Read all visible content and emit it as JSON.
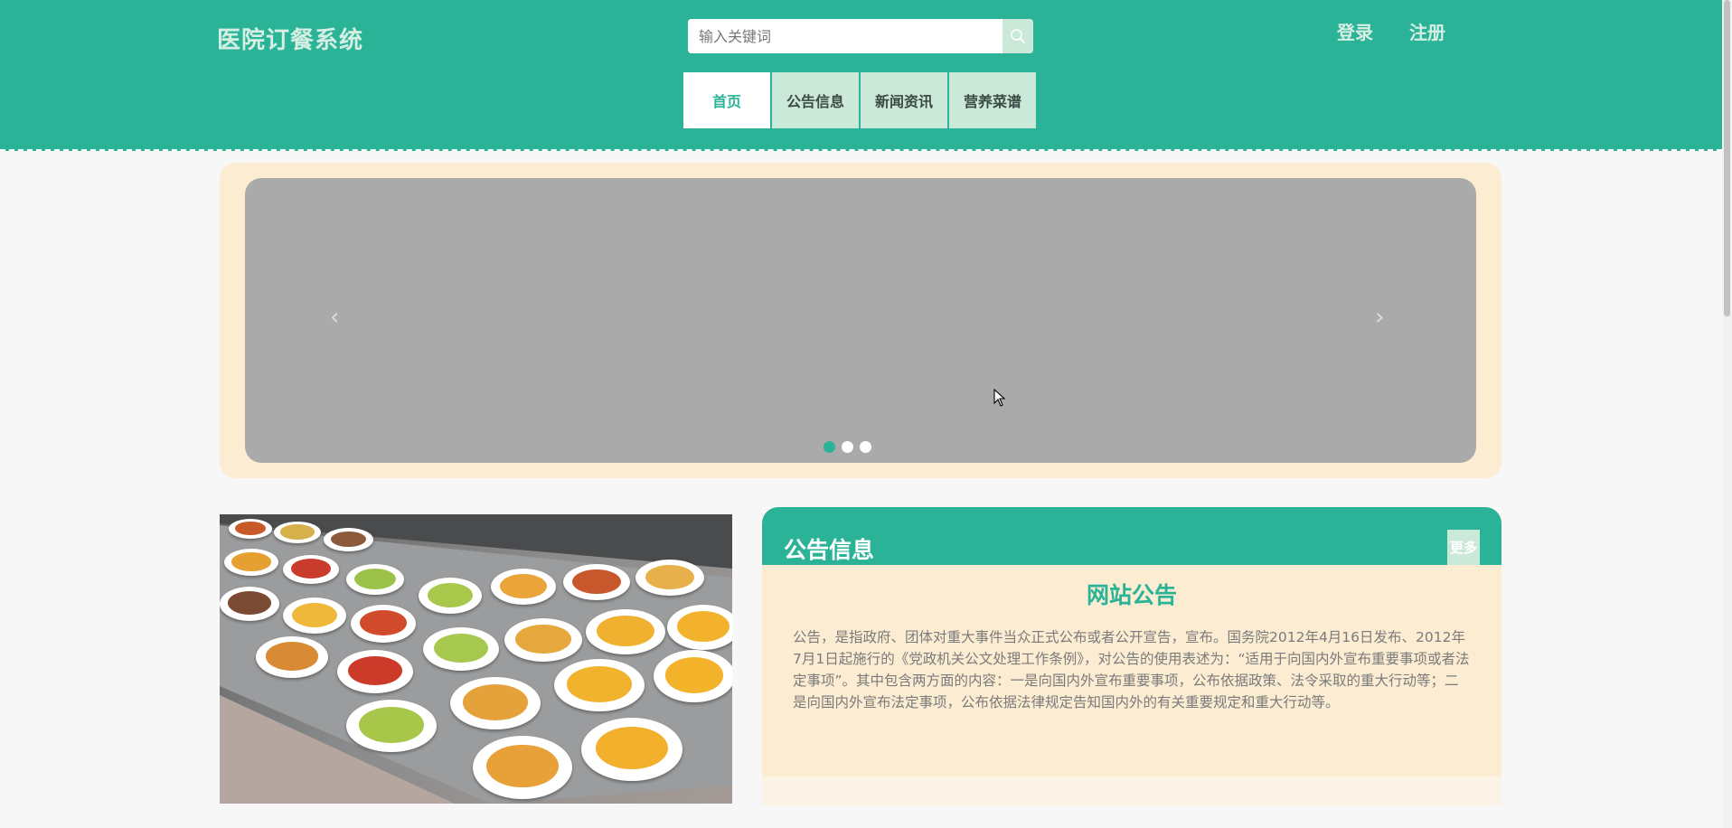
{
  "header": {
    "site_title": "医院订餐系统",
    "search": {
      "placeholder": "输入关键词"
    },
    "login_label": "登录",
    "register_label": "注册",
    "nav": [
      {
        "label": "首页",
        "active": true
      },
      {
        "label": "公告信息",
        "active": false
      },
      {
        "label": "新闻资讯",
        "active": false
      },
      {
        "label": "营养菜谱",
        "active": false
      }
    ]
  },
  "carousel": {
    "prev_icon": "chevron-left-icon",
    "next_icon": "chevron-right-icon",
    "prev_glyph": "‹",
    "next_glyph": "›",
    "slide_count": 3,
    "active_slide": 1
  },
  "notice": {
    "title": "公告信息",
    "more_label": "更多",
    "subtitle": "网站公告",
    "body": "公告，是指政府、团体对重大事件当众正式公布或者公开宣告，宣布。国务院2012年4月16日发布、2012年7月1日起施行的《党政机关公文处理工作条例》，对公告的使用表述为：“适用于向国内外宣布重要事项或者法定事项”。其中包含两方面的内容：一是向国内外宣布重要事项，公布依据政策、法令采取的重大行动等；二是向国内外宣布法定事项，公布依据法律规定告知国内外的有关重要规定和重大行动等。"
  },
  "colors": {
    "primary": "#2ab397",
    "nav_bg": "#cbe9d8",
    "panel_bg": "#fbecd2",
    "carousel_bg": "#aaaaaa"
  }
}
